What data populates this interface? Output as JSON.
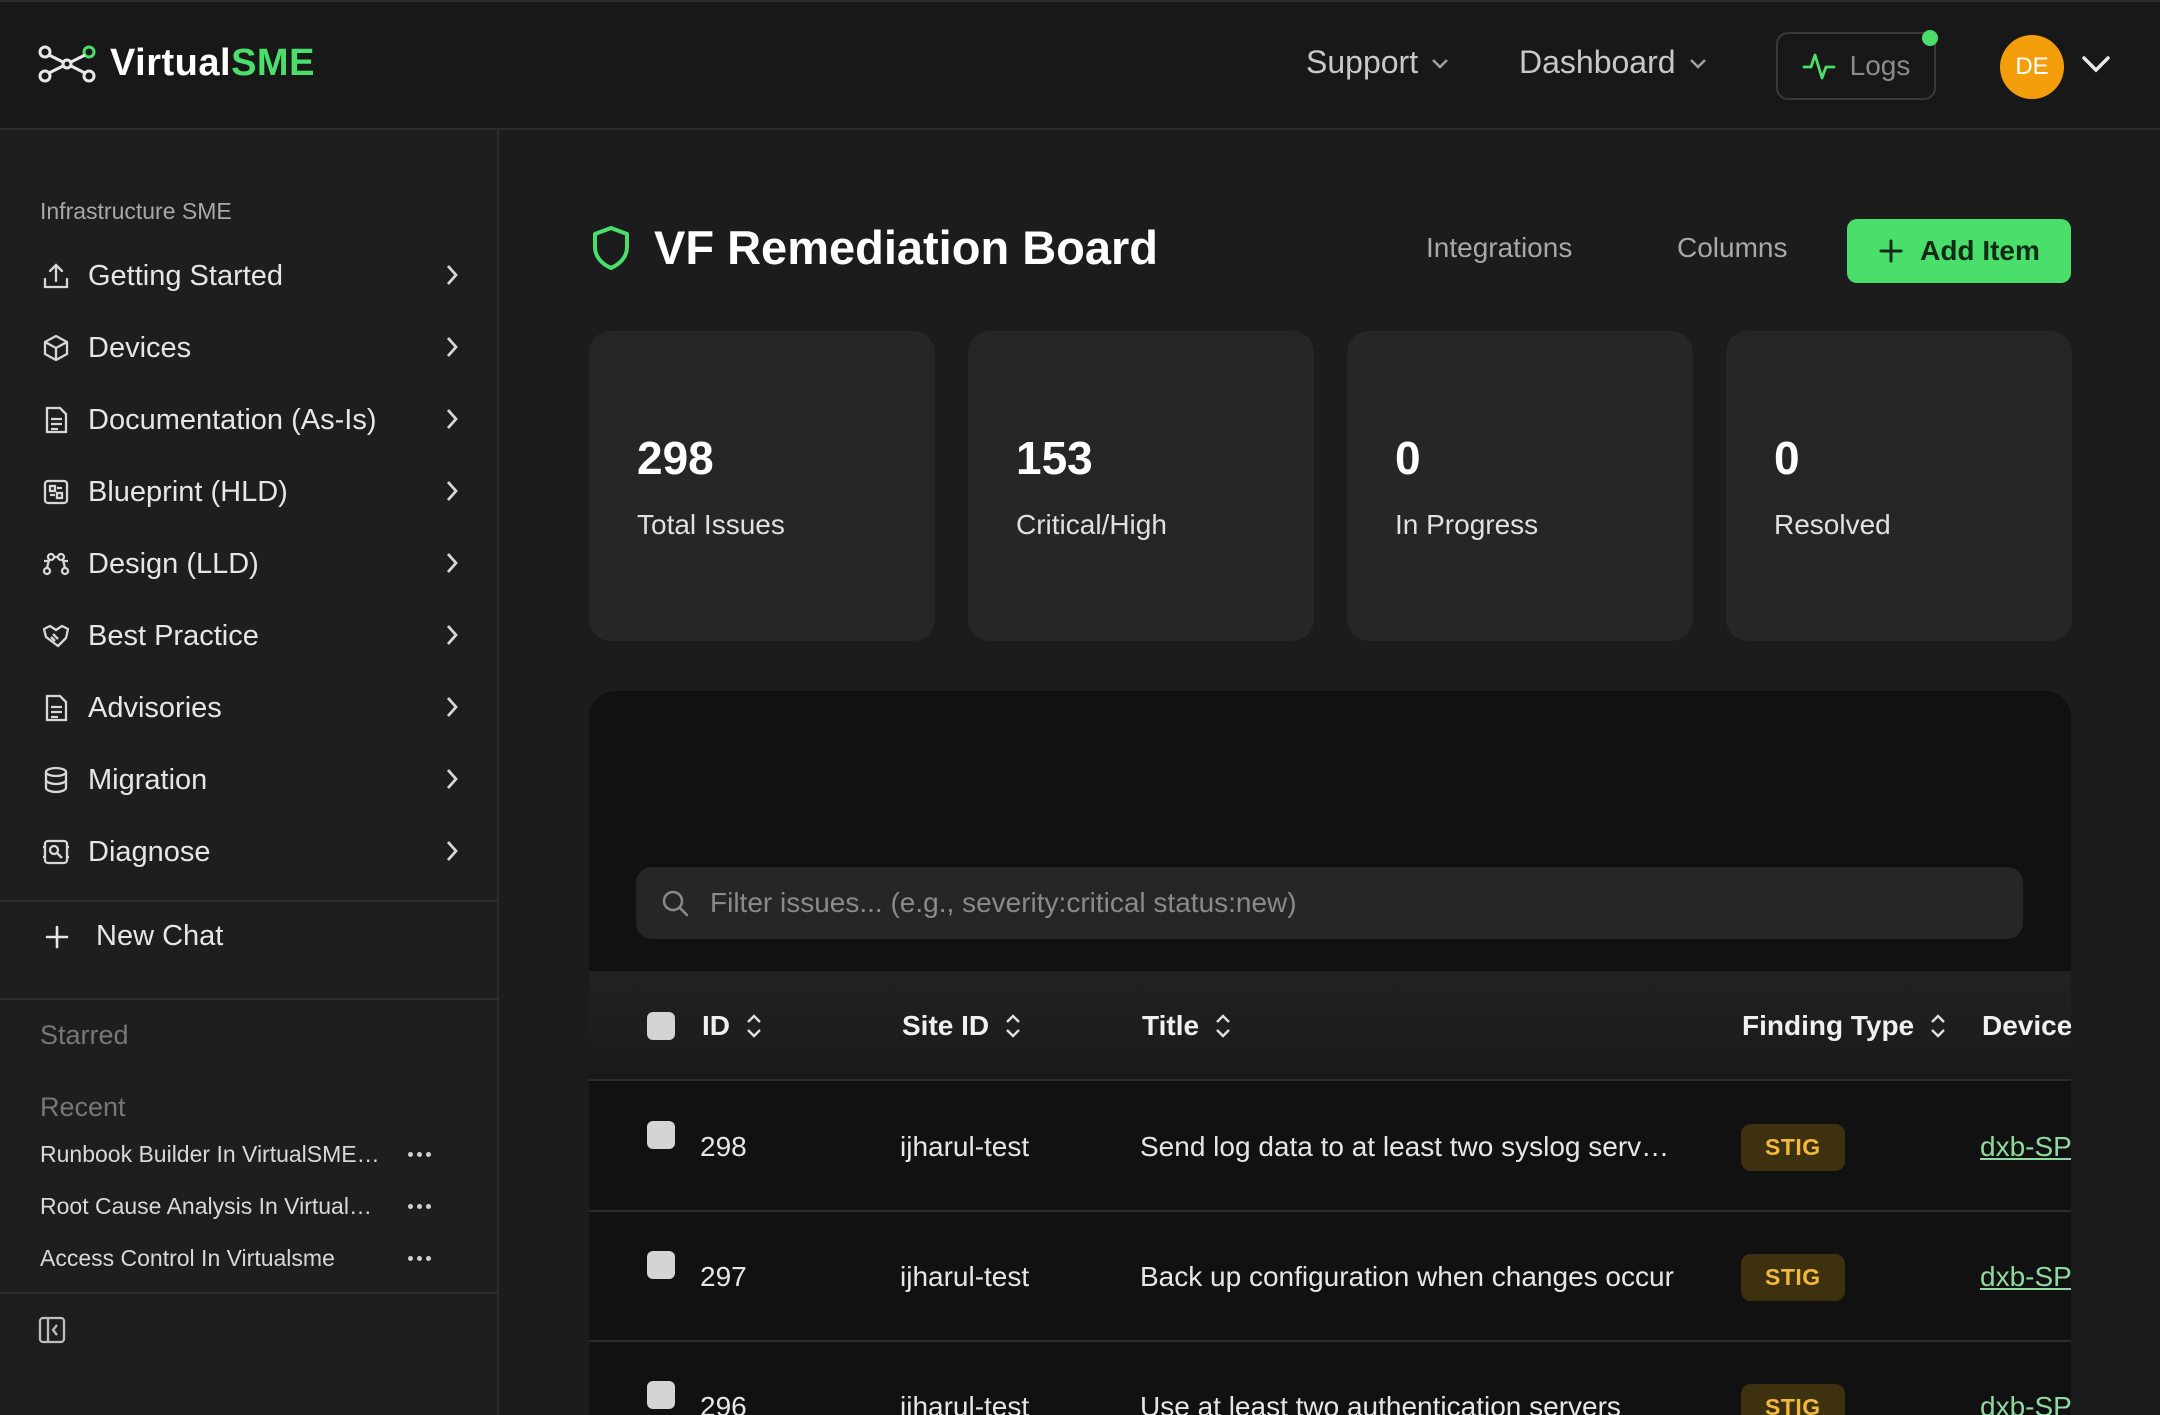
{
  "app": {
    "brand_main": "Virtual",
    "brand_accent": "SME"
  },
  "topnav": {
    "support": "Support",
    "dashboard": "Dashboard",
    "logs": "Logs",
    "avatar_initials": "DE"
  },
  "sidebar": {
    "section_label": "Infrastructure SME",
    "items": [
      {
        "label": "Getting Started",
        "icon": "upload-icon"
      },
      {
        "label": "Devices",
        "icon": "box-icon"
      },
      {
        "label": "Documentation (As-Is)",
        "icon": "document-icon"
      },
      {
        "label": "Blueprint (HLD)",
        "icon": "blueprint-icon"
      },
      {
        "label": "Design (LLD)",
        "icon": "network-icon"
      },
      {
        "label": "Best Practice",
        "icon": "handshake-icon"
      },
      {
        "label": "Advisories",
        "icon": "document-icon"
      },
      {
        "label": "Migration",
        "icon": "database-icon"
      },
      {
        "label": "Diagnose",
        "icon": "diagnose-icon"
      }
    ],
    "new_chat": "New Chat",
    "starred": "Starred",
    "recent": "Recent",
    "recent_items": [
      "Runbook Builder In VirtualSME Platform",
      "Root Cause Analysis In VirtualSME",
      "Access Control In Virtualsme"
    ]
  },
  "page": {
    "title": "VF Remediation Board",
    "integrations": "Integrations",
    "columns": "Columns",
    "add_item": "Add Item"
  },
  "stats": [
    {
      "value": "298",
      "label": "Total Issues"
    },
    {
      "value": "153",
      "label": "Critical/High"
    },
    {
      "value": "0",
      "label": "In Progress"
    },
    {
      "value": "0",
      "label": "Resolved"
    }
  ],
  "table": {
    "search_placeholder": "Filter issues... (e.g., severity:critical status:new)",
    "headers": {
      "id": "ID",
      "site_id": "Site ID",
      "title": "Title",
      "finding_type": "Finding Type",
      "device": "Device"
    },
    "rows": [
      {
        "id": "298",
        "site_id": "ijharul-test",
        "title": "Send log data to at least two syslog servers",
        "finding_type": "STIG",
        "device": "dxb-SPI"
      },
      {
        "id": "297",
        "site_id": "ijharul-test",
        "title": "Back up configuration when changes occur",
        "finding_type": "STIG",
        "device": "dxb-SPI"
      },
      {
        "id": "296",
        "site_id": "ijharul-test",
        "title": "Use at least two authentication servers",
        "finding_type": "STIG",
        "device": "dxb-SPI"
      }
    ]
  },
  "colors": {
    "accent": "#4ade6b",
    "avatar": "#f59e0b",
    "badge_bg": "#3d3110",
    "badge_text": "#f5b93a"
  }
}
